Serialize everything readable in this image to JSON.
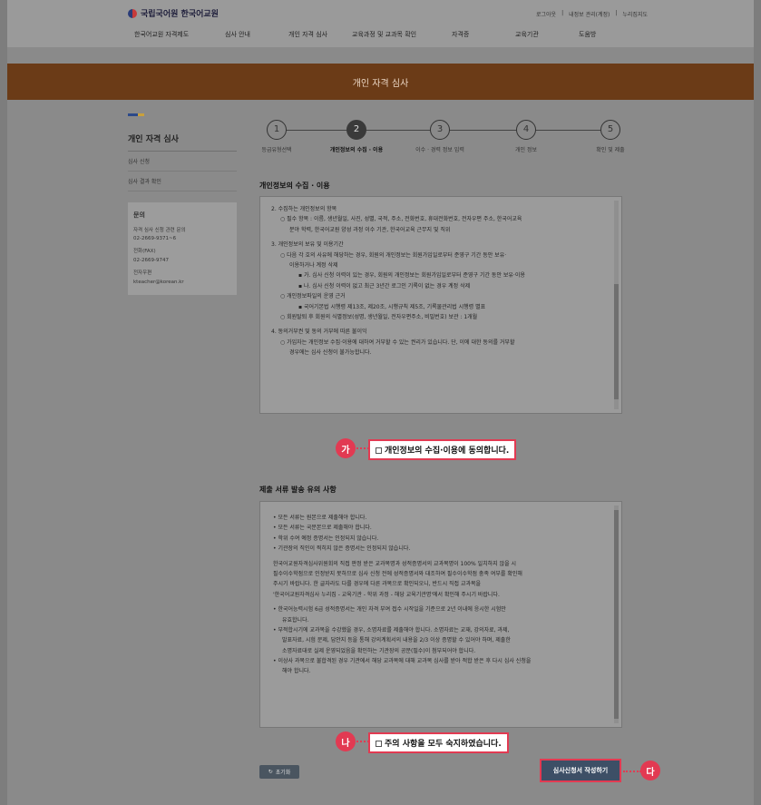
{
  "header": {
    "logo_text": "국립국어원 한국어교원",
    "util": [
      "로그아웃",
      "내정보 관리(계정)",
      "누리집지도"
    ],
    "nav": [
      "한국어교원 자격제도",
      "심사 안내",
      "개인 자격 심사",
      "교육과정 및 교과목 확인",
      "자격증",
      "교육기관",
      "도움방"
    ]
  },
  "banner": {
    "title": "개인 자격 심사"
  },
  "sidebar": {
    "title": "개인 자격 심사",
    "items": [
      "심사 신청",
      "심사 결과 확인"
    ],
    "contact": {
      "title": "문의",
      "lines": [
        "자격 심사 신청 관련 문의",
        "02-2669-9371~6",
        "전화(FAX)",
        "02-2669-9747",
        "전자우편",
        "kteacher@korean.kr"
      ]
    }
  },
  "steps": [
    {
      "num": "1",
      "label": "등급유형선택",
      "active": false
    },
    {
      "num": "2",
      "label": "개인정보의 수집 · 이용",
      "active": true
    },
    {
      "num": "3",
      "label": "이수 · 경력 정보 입력",
      "active": false
    },
    {
      "num": "4",
      "label": "개인 정보",
      "active": false
    },
    {
      "num": "5",
      "label": "확인 및 제출",
      "active": false
    }
  ],
  "privacy": {
    "title": "개인정보의 수집 · 이용",
    "lines": [
      "2. 수집하는 개인정보의 항목",
      "○ 필수 항목 : 이름, 생년월일, 사진, 성별, 국적, 주소, 전화번호, 휴대전화번호, 전자우편 주소, 한국어교육",
      "분야 학력, 한국어교원 양성 과정 이수 기관, 한국어교육 근무지 및 직위",
      "3. 개인정보의 보유 및 이용기간",
      "○ 다음 각 호의 사유에 해당하는 경우, 회원의 개인정보는 회원가입일로부터 준영구 기간 동안 보유·",
      "이용하거나 계정 삭제",
      "▪ 가. 심사 신청 이력이 있는 경우, 회원의 개인정보는 회원가입일로부터 준영구 기간 동안 보유·이용",
      "▪ 나. 심사 신청 이력이 없고 최근 3년간 로그인 기록이 없는 경우 계정 삭제",
      "○ 개인정보파일의 운영 근거",
      "▪ 국어기본법 시행령 제13조, 제20조, 시행규칙 제5조, 기록물관리법 시행령 별표",
      "○ 회원탈퇴 후 회원의 식별정보(성명, 생년월일, 전자우편주소, 비밀번호) 보관 : 1개월",
      "4. 동의거부권 및 동의 거부에 따른 불이익",
      "○ 가입자는 개인정보 수집·이용에 대하여 거부할 수 있는 권리가 있습니다. 단, 이에 대한 동의를 거부할",
      "경우에는 심사 신청이 불가능합니다."
    ],
    "agree_label": "개인정보의 수집·이용에 동의합니다.",
    "badge": "가"
  },
  "notice": {
    "title": "제출 서류 발송 유의 사항",
    "bullets1": [
      "• 모든 서류는 원본으로 제출해야 합니다.",
      "• 모든 서류는 국문본으로 제출해야 합니다.",
      "• 학위 수여 예정 증명서는 인정되지 않습니다.",
      "• 기관장의 직인이 찍히지 않은 증명서는 인정되지 않습니다."
    ],
    "para": [
      "한국어교원자격심사위원회의 직접 판정 받은 교과목명과 성적증명서의 교과목명이 100% 일치하지 않을 시",
      "필수이수학점으로 인정받지 못하므로 심사 신청 전에 성적증명서와 대조하여 필수이수학점 충족 여부를 확인해",
      "주시기 바랍니다. 한 글자라도 다를 경우에 다른 과목으로 확인되오니, 반드시 직접 교과목을",
      "'한국어교원자격심사 누리집 - 교육기관 - 학위 과정 - 해당 교육기관명'에서 확인해 주시기 바랍니다."
    ],
    "bullets2": [
      "• 한국어능력시험 6급 성적증명서는 개인 자격 부여 접수 시작일을 기준으로 2년 이내에 응시한 시험만",
      "유효합니다.",
      "• 부적합시기에 교과목을 수강했을 경우, 소명자료를 제출해야 합니다. 소명자료는 교재, 강의자료, 과제,",
      "발표자료, 시험 문제, 답안지 등을 통해 강의계획서의 내용을 2/3 이상 증명할 수 있어야 하며, 제출한",
      "소명자료대로 실제 운영되었음을 확인하는 기관장의 공문(필수)이 첨부되어야 합니다.",
      "• 이상사 과목으로 불합격된 경우 기관에서 해당 교과목에 대해 교과목 심사를 받아 적합 받은 후 다시 심사 신청을",
      "해야 합니다."
    ],
    "agree_label": "주의 사항을 모두 숙지하였습니다.",
    "badge": "나"
  },
  "buttons": {
    "reset": "초기화",
    "submit": "심사신청서 작성하기",
    "submit_badge": "다"
  }
}
